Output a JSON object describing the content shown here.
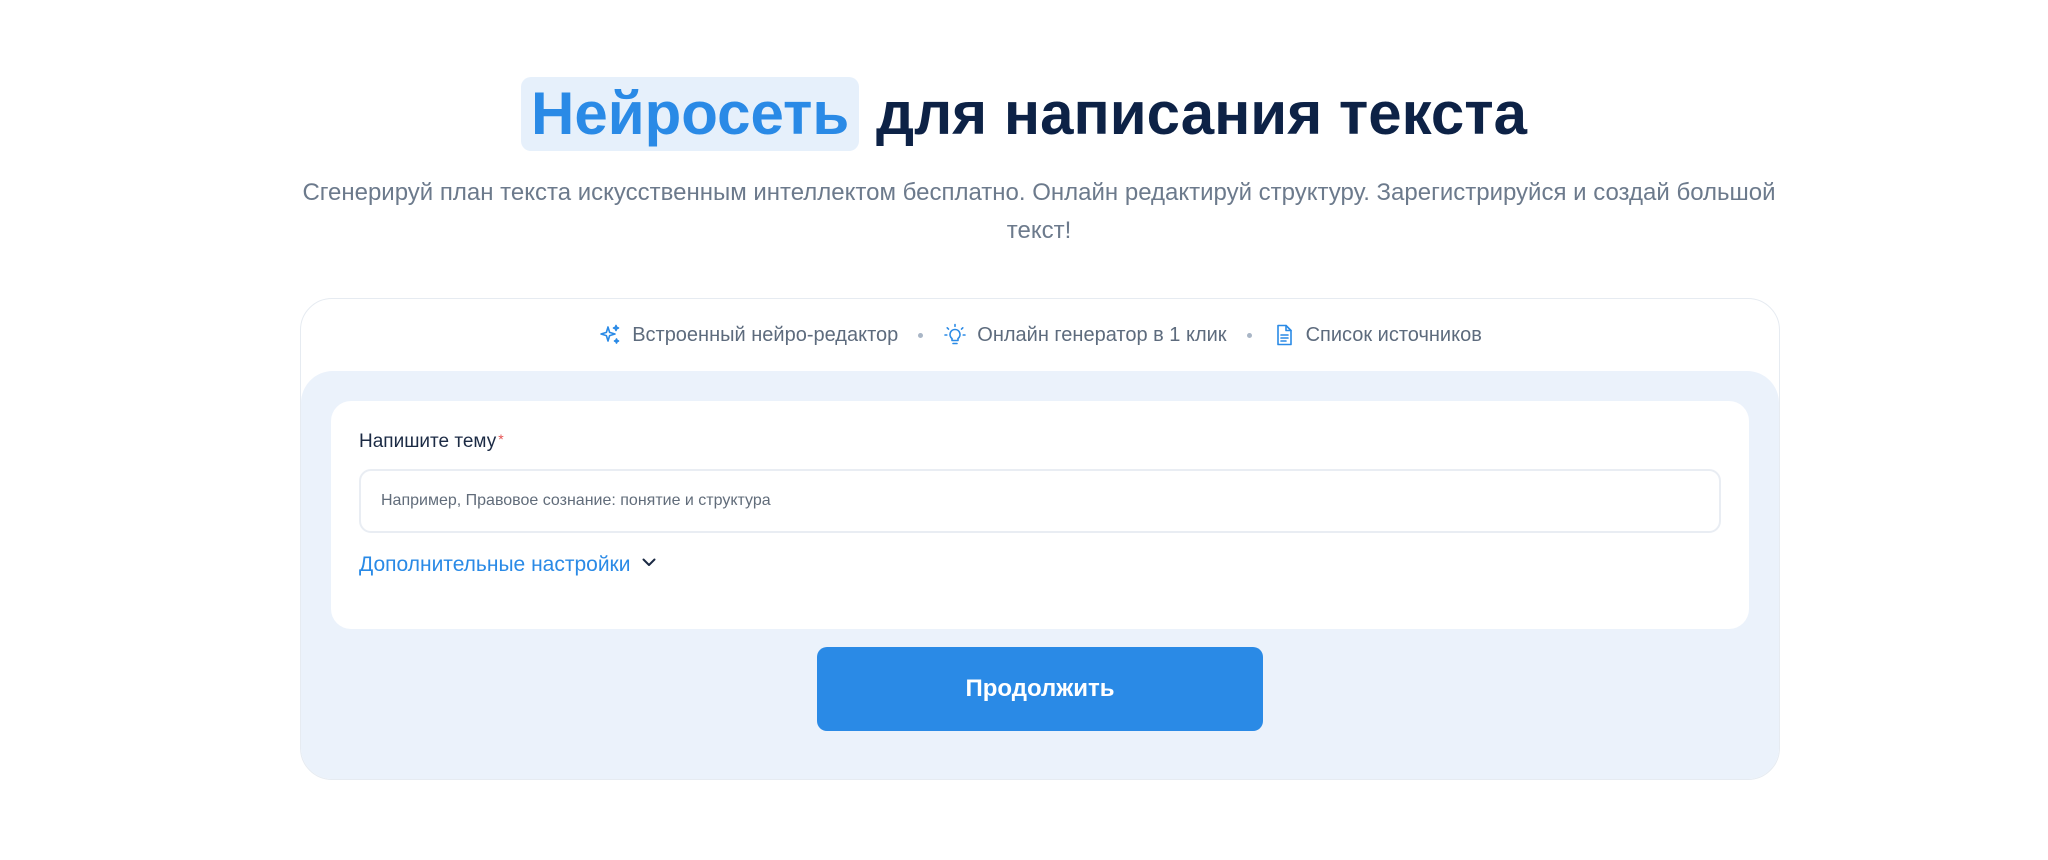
{
  "hero": {
    "title_highlight": "Нейросеть",
    "title_rest": " для написания текста",
    "subtitle": "Сгенерируй план текста искусственным интеллектом бесплатно. Онлайн редактируй структуру. Зарегистрируйся и создай большой текст!"
  },
  "features": [
    {
      "icon": "sparkles-icon",
      "label": "Встроенный нейро-редактор"
    },
    {
      "icon": "lightbulb-icon",
      "label": "Онлайн генератор в 1 клик"
    },
    {
      "icon": "document-icon",
      "label": "Список источников"
    }
  ],
  "form": {
    "topic_label": "Напишите тему",
    "required_mark": "*",
    "topic_placeholder": "Например, Правовое сознание: понятие и структура",
    "topic_value": "",
    "advanced_settings_label": "Дополнительные настройки",
    "continue_label": "Продолжить"
  },
  "colors": {
    "accent": "#2a8ae6",
    "heading": "#0d2246",
    "muted": "#6c7a8c",
    "panel_bg": "#ebf2fb",
    "required": "#e55151"
  }
}
